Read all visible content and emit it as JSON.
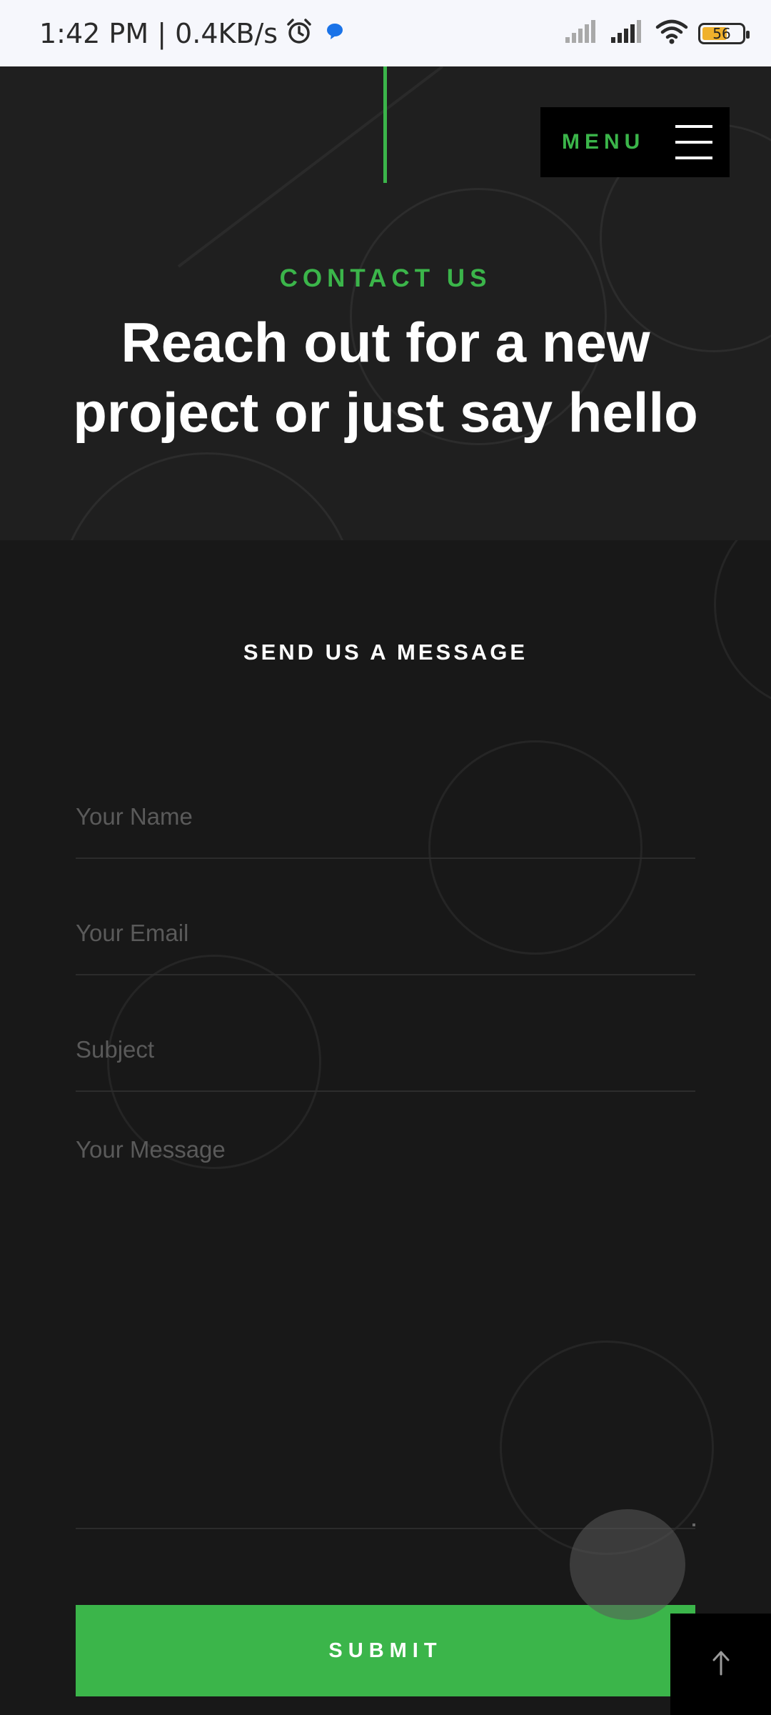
{
  "status_bar": {
    "time_and_speed": "1:42 PM | 0.4KB/s",
    "battery_level": "56",
    "icons": [
      "alarm-icon",
      "messenger-icon",
      "signal-icon",
      "signal-icon",
      "wifi-icon",
      "battery-icon"
    ]
  },
  "header": {
    "menu_label": "MENU",
    "accent_color": "#3bb54a"
  },
  "hero": {
    "eyebrow": "CONTACT US",
    "headline": "Reach out for a new project or just say hello"
  },
  "form": {
    "title": "SEND US A MESSAGE",
    "name_placeholder": "Your Name",
    "email_placeholder": "Your Email",
    "subject_placeholder": "Subject",
    "message_placeholder": "Your Message",
    "submit_label": "SUBMIT"
  },
  "scroll_top": {
    "icon": "arrow-up-icon"
  }
}
